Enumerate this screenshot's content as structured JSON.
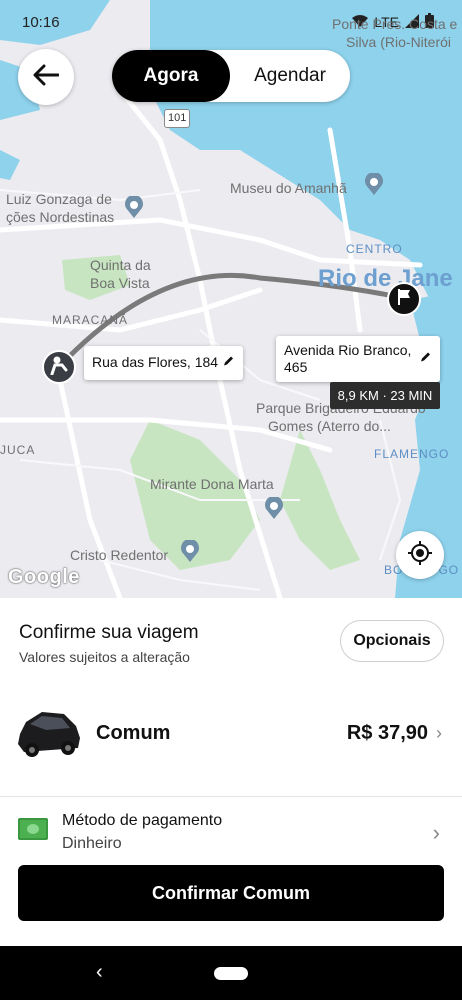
{
  "status_bar": {
    "time": "10:16",
    "network": "LTE"
  },
  "mode_toggle": {
    "active": "Agora",
    "inactive": "Agendar"
  },
  "map": {
    "labels": {
      "ponte": "Ponte Pres. Costa e",
      "silva": "Silva (Rio-Niterói",
      "route101": "101",
      "museu": "Museu do Amanhã",
      "luiz1": "Luiz Gonzaga de",
      "luiz2": "ções Nordestinas",
      "quinta1": "Quinta da",
      "quinta2": "Boa Vista",
      "centro": "CENTRO",
      "rio": "Rio de Jane",
      "maracana": "MARACANÃ",
      "parque1": "Parque Brigadeiro Eduardo",
      "parque2": "Gomes (Aterro do...",
      "juca": "JUCA",
      "flamengo": "FLAMENGO",
      "mirante": "Mirante Dona Marta",
      "cristo": "Cristo Redentor",
      "botafogo": "BOTAFOGO"
    },
    "origin": "Rua das Flores, 184",
    "destination_line1": "Avenida Rio Branco,",
    "destination_line2": "465",
    "eta": "8,9 KM · 23 MIN",
    "attribution": "Google",
    "colors": {
      "water": "#8ed2ec",
      "land": "#ecebf0",
      "park": "#c7e5c0",
      "route": "#7a7a7a"
    }
  },
  "sheet": {
    "title": "Confirme sua viagem",
    "subtitle": "Valores sujeitos a alteração",
    "options_button": "Opcionais",
    "car": {
      "name": "Comum",
      "price": "R$ 37,90"
    },
    "payment": {
      "title": "Método de pagamento",
      "value": "Dinheiro"
    },
    "confirm_button": "Confirmar Comum"
  },
  "icons": {
    "back": "arrow-left-icon",
    "locate": "crosshair-icon",
    "origin_pin": "person-icon",
    "destination_pin": "flag-icon",
    "edit": "pencil-icon",
    "payment": "cash-icon"
  }
}
